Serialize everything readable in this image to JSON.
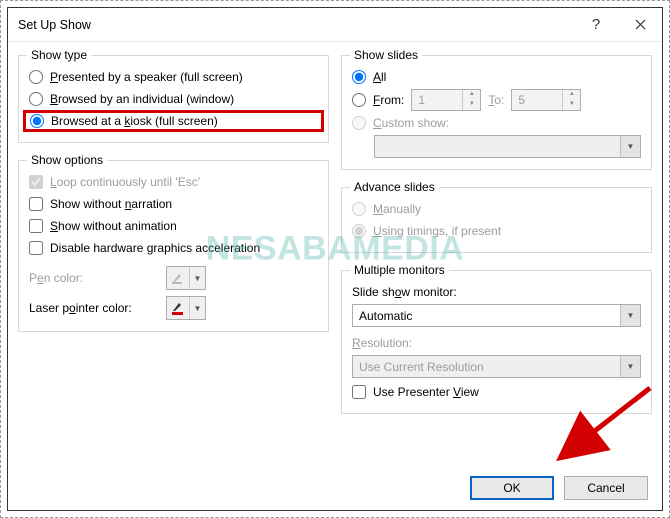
{
  "title": "Set Up Show",
  "show_type": {
    "legend": "Show type",
    "opt_presented": "Presented by a speaker (full screen)",
    "opt_browsed_individual": "Browsed by an individual (window)",
    "opt_kiosk": "Browsed at a kiosk (full screen)"
  },
  "show_options": {
    "legend": "Show options",
    "loop": "Loop continuously until 'Esc'",
    "no_narration": "Show without narration",
    "no_animation": "Show without animation",
    "disable_hw": "Disable hardware graphics acceleration",
    "pen_color_label": "Pen color:",
    "laser_color_label": "Laser pointer color:"
  },
  "show_slides": {
    "legend": "Show slides",
    "all": "All",
    "from": "From:",
    "to": "To:",
    "from_val": "1",
    "to_val": "5",
    "custom": "Custom show:",
    "custom_val": ""
  },
  "advance": {
    "legend": "Advance slides",
    "manually": "Manually",
    "timings": "Using timings, if present"
  },
  "monitors": {
    "legend": "Multiple monitors",
    "monitor_label": "Slide show monitor:",
    "monitor_val": "Automatic",
    "resolution_label": "Resolution:",
    "resolution_val": "Use Current Resolution",
    "presenter_view": "Use Presenter View"
  },
  "buttons": {
    "ok": "OK",
    "cancel": "Cancel"
  },
  "watermark": "NESABAMEDIA"
}
